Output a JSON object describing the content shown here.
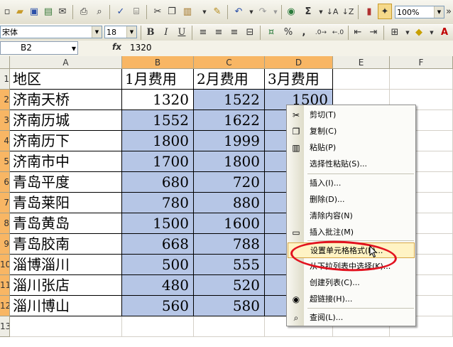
{
  "toolbar": {
    "zoom": "100%",
    "font_name": "宋体",
    "font_size": "18",
    "bold": "B",
    "italic": "I",
    "underline": "U",
    "sum": "Σ",
    "percent": "%",
    "comma": ","
  },
  "formula_bar": {
    "name_box": "B2",
    "fx": "fx",
    "value": "1320"
  },
  "sheet": {
    "columns": [
      "A",
      "B",
      "C",
      "D",
      "E",
      "F"
    ],
    "row_numbers": [
      "1",
      "2",
      "3",
      "4",
      "5",
      "6",
      "7",
      "8",
      "9",
      "10",
      "11",
      "12",
      "13"
    ],
    "header": [
      "地区",
      "1月费用",
      "2月费用",
      "3月费用"
    ],
    "rows": [
      {
        "region": "济南天桥",
        "m1": "1320",
        "m2": "1522",
        "m3": "1500"
      },
      {
        "region": "济南历城",
        "m1": "1552",
        "m2": "1622",
        "m3": ""
      },
      {
        "region": "济南历下",
        "m1": "1800",
        "m2": "1999",
        "m3": ""
      },
      {
        "region": "济南市中",
        "m1": "1700",
        "m2": "1800",
        "m3": ""
      },
      {
        "region": "青岛平度",
        "m1": "680",
        "m2": "720",
        "m3": ""
      },
      {
        "region": "青岛莱阳",
        "m1": "780",
        "m2": "880",
        "m3": ""
      },
      {
        "region": "青岛黄岛",
        "m1": "1500",
        "m2": "1600",
        "m3": ""
      },
      {
        "region": "青岛胶南",
        "m1": "668",
        "m2": "788",
        "m3": ""
      },
      {
        "region": "淄博淄川",
        "m1": "500",
        "m2": "555",
        "m3": ""
      },
      {
        "region": "淄川张店",
        "m1": "480",
        "m2": "520",
        "m3": ""
      },
      {
        "region": "淄川博山",
        "m1": "560",
        "m2": "580",
        "m3": ""
      }
    ]
  },
  "context_menu": {
    "items": [
      {
        "label": "剪切(T)",
        "icon": "scissors-icon"
      },
      {
        "label": "复制(C)",
        "icon": "copy-icon"
      },
      {
        "label": "粘贴(P)",
        "icon": "paste-icon"
      },
      {
        "label": "选择性粘贴(S)...",
        "icon": ""
      },
      {
        "label": "插入(I)...",
        "icon": ""
      },
      {
        "label": "删除(D)...",
        "icon": ""
      },
      {
        "label": "清除内容(N)",
        "icon": ""
      },
      {
        "label": "插入批注(M)",
        "icon": "comment-icon"
      },
      {
        "label": "设置单元格格式(F)...",
        "icon": ""
      },
      {
        "label": "从下拉列表中选择(K)...",
        "icon": ""
      },
      {
        "label": "创建列表(C)...",
        "icon": ""
      },
      {
        "label": "超链接(H)...",
        "icon": "hyperlink-icon"
      },
      {
        "label": "查阅(L)...",
        "icon": "lookup-icon"
      }
    ],
    "highlighted": "设置单元格格式(F)..."
  },
  "colors": {
    "selection": "#b6c6e6",
    "header_selected": "#f8b664",
    "annotation": "#e2121f"
  }
}
